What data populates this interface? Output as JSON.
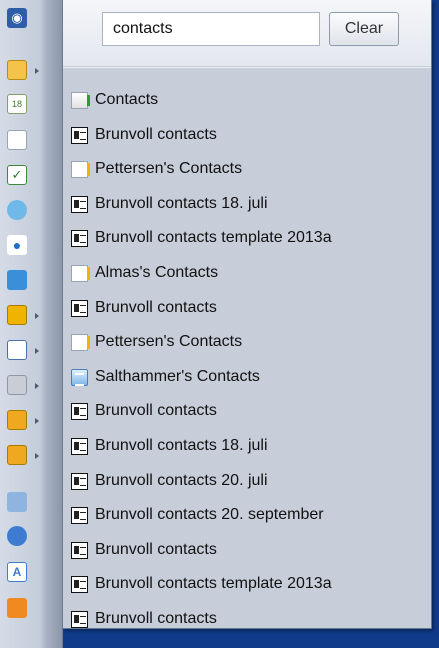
{
  "search": {
    "value": "contacts",
    "clear_label": "Clear"
  },
  "rail_icons": [
    {
      "name": "binoculars-icon"
    },
    {
      "name": "mail-icon"
    },
    {
      "name": "calendar-icon"
    },
    {
      "name": "contacts-icon"
    },
    {
      "name": "tasks-icon"
    },
    {
      "name": "sync-icon"
    },
    {
      "name": "user-icon"
    },
    {
      "name": "refresh-icon"
    },
    {
      "name": "folder-icon"
    },
    {
      "name": "folder-list-icon"
    },
    {
      "name": "folder-gray-icon"
    },
    {
      "name": "folder-shared-icon"
    },
    {
      "name": "folder-notes-icon"
    },
    {
      "name": "edit-icon"
    },
    {
      "name": "globe-icon"
    },
    {
      "name": "document-icon"
    },
    {
      "name": "archive-icon"
    }
  ],
  "results": [
    {
      "label": "Contacts",
      "icon": "folder"
    },
    {
      "label": "Brunvoll contacts",
      "icon": "card"
    },
    {
      "label": "Pettersen's Contacts",
      "icon": "shared"
    },
    {
      "label": "Brunvoll contacts 18. juli",
      "icon": "card"
    },
    {
      "label": "Brunvoll contacts template 2013a",
      "icon": "card"
    },
    {
      "label": "Almas's Contacts",
      "icon": "shared"
    },
    {
      "label": "Brunvoll contacts",
      "icon": "card"
    },
    {
      "label": "Pettersen's Contacts",
      "icon": "shared"
    },
    {
      "label": "Salthammer's Contacts",
      "icon": "list"
    },
    {
      "label": "Brunvoll contacts",
      "icon": "card"
    },
    {
      "label": "Brunvoll contacts 18. juli",
      "icon": "card"
    },
    {
      "label": "Brunvoll contacts 20. juli",
      "icon": "card"
    },
    {
      "label": "Brunvoll contacts 20. september",
      "icon": "card"
    },
    {
      "label": "Brunvoll contacts",
      "icon": "card"
    },
    {
      "label": "Brunvoll contacts template 2013a",
      "icon": "card"
    },
    {
      "label": "Brunvoll contacts",
      "icon": "card"
    }
  ],
  "colors": {
    "desktop": "#0f3b8a",
    "panel": "#eaedf2",
    "results_bg": "#c8ced9"
  }
}
